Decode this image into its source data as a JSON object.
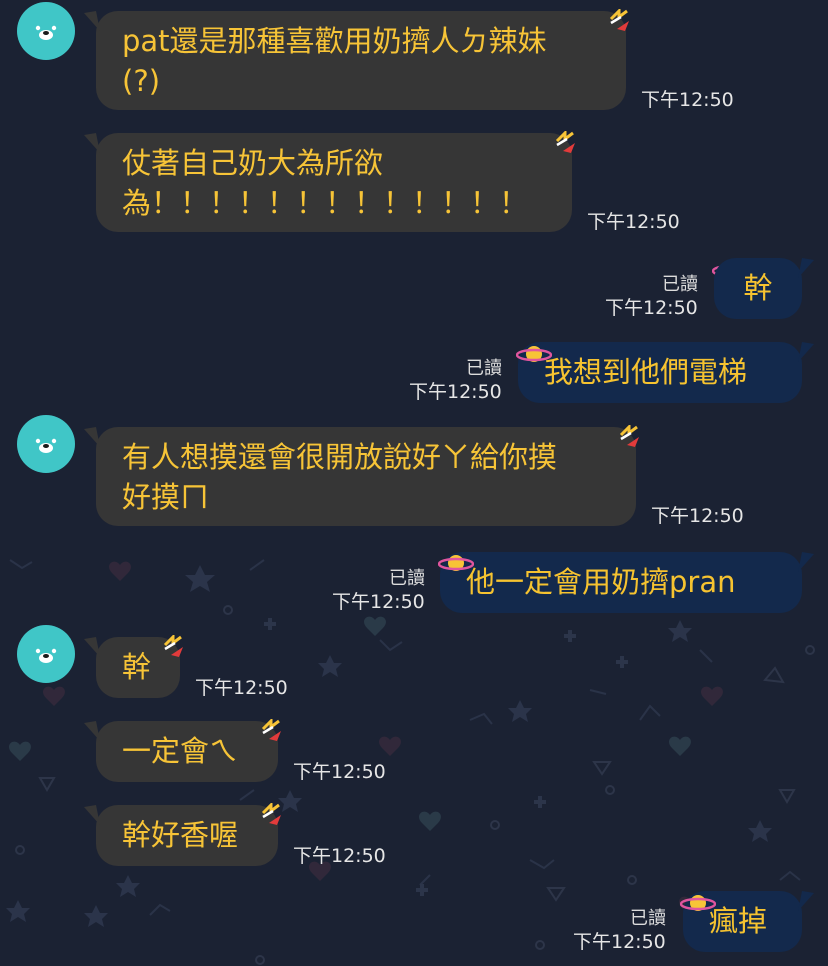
{
  "messages": [
    {
      "side": "in",
      "text": "pat還是那種喜歡用奶擠人ㄉ辣妹\n(?)",
      "time": "下午12:50",
      "avatar": true
    },
    {
      "side": "in",
      "text": "仗著自己奶大為所欲\n為！！！！！！！！！！！！！",
      "time": "下午12:50",
      "avatar": false
    },
    {
      "side": "out",
      "text": "幹",
      "time": "下午12:50",
      "read": "已讀"
    },
    {
      "side": "out",
      "text": "我想到他們電梯",
      "time": "下午12:50",
      "read": "已讀"
    },
    {
      "side": "in",
      "text": "有人想摸還會很開放說好ㄚ給你摸\n好摸ㄇ",
      "time": "下午12:50",
      "avatar": true
    },
    {
      "side": "out",
      "text": "他一定會用奶擠pran",
      "time": "下午12:50",
      "read": "已讀"
    },
    {
      "side": "in",
      "text": "幹",
      "time": "下午12:50",
      "avatar": true
    },
    {
      "side": "in",
      "text": "一定會ㄟ",
      "time": "下午12:50",
      "avatar": false
    },
    {
      "side": "in",
      "text": "幹好香喔",
      "time": "下午12:50",
      "avatar": false
    },
    {
      "side": "out",
      "text": "瘋掉",
      "time": "下午12:50",
      "read": "已讀"
    }
  ],
  "colors": {
    "background": "#1b2233",
    "incoming_bubble": "#363636",
    "outgoing_bubble": "#13294c",
    "message_text": "#f7c437",
    "avatar": "#40c6c7"
  },
  "icons": {
    "avatar": "bear-face-avatar-icon",
    "incoming_deco": "lightning-bolt-deco-icon",
    "outgoing_deco": "planet-deco-icon"
  }
}
